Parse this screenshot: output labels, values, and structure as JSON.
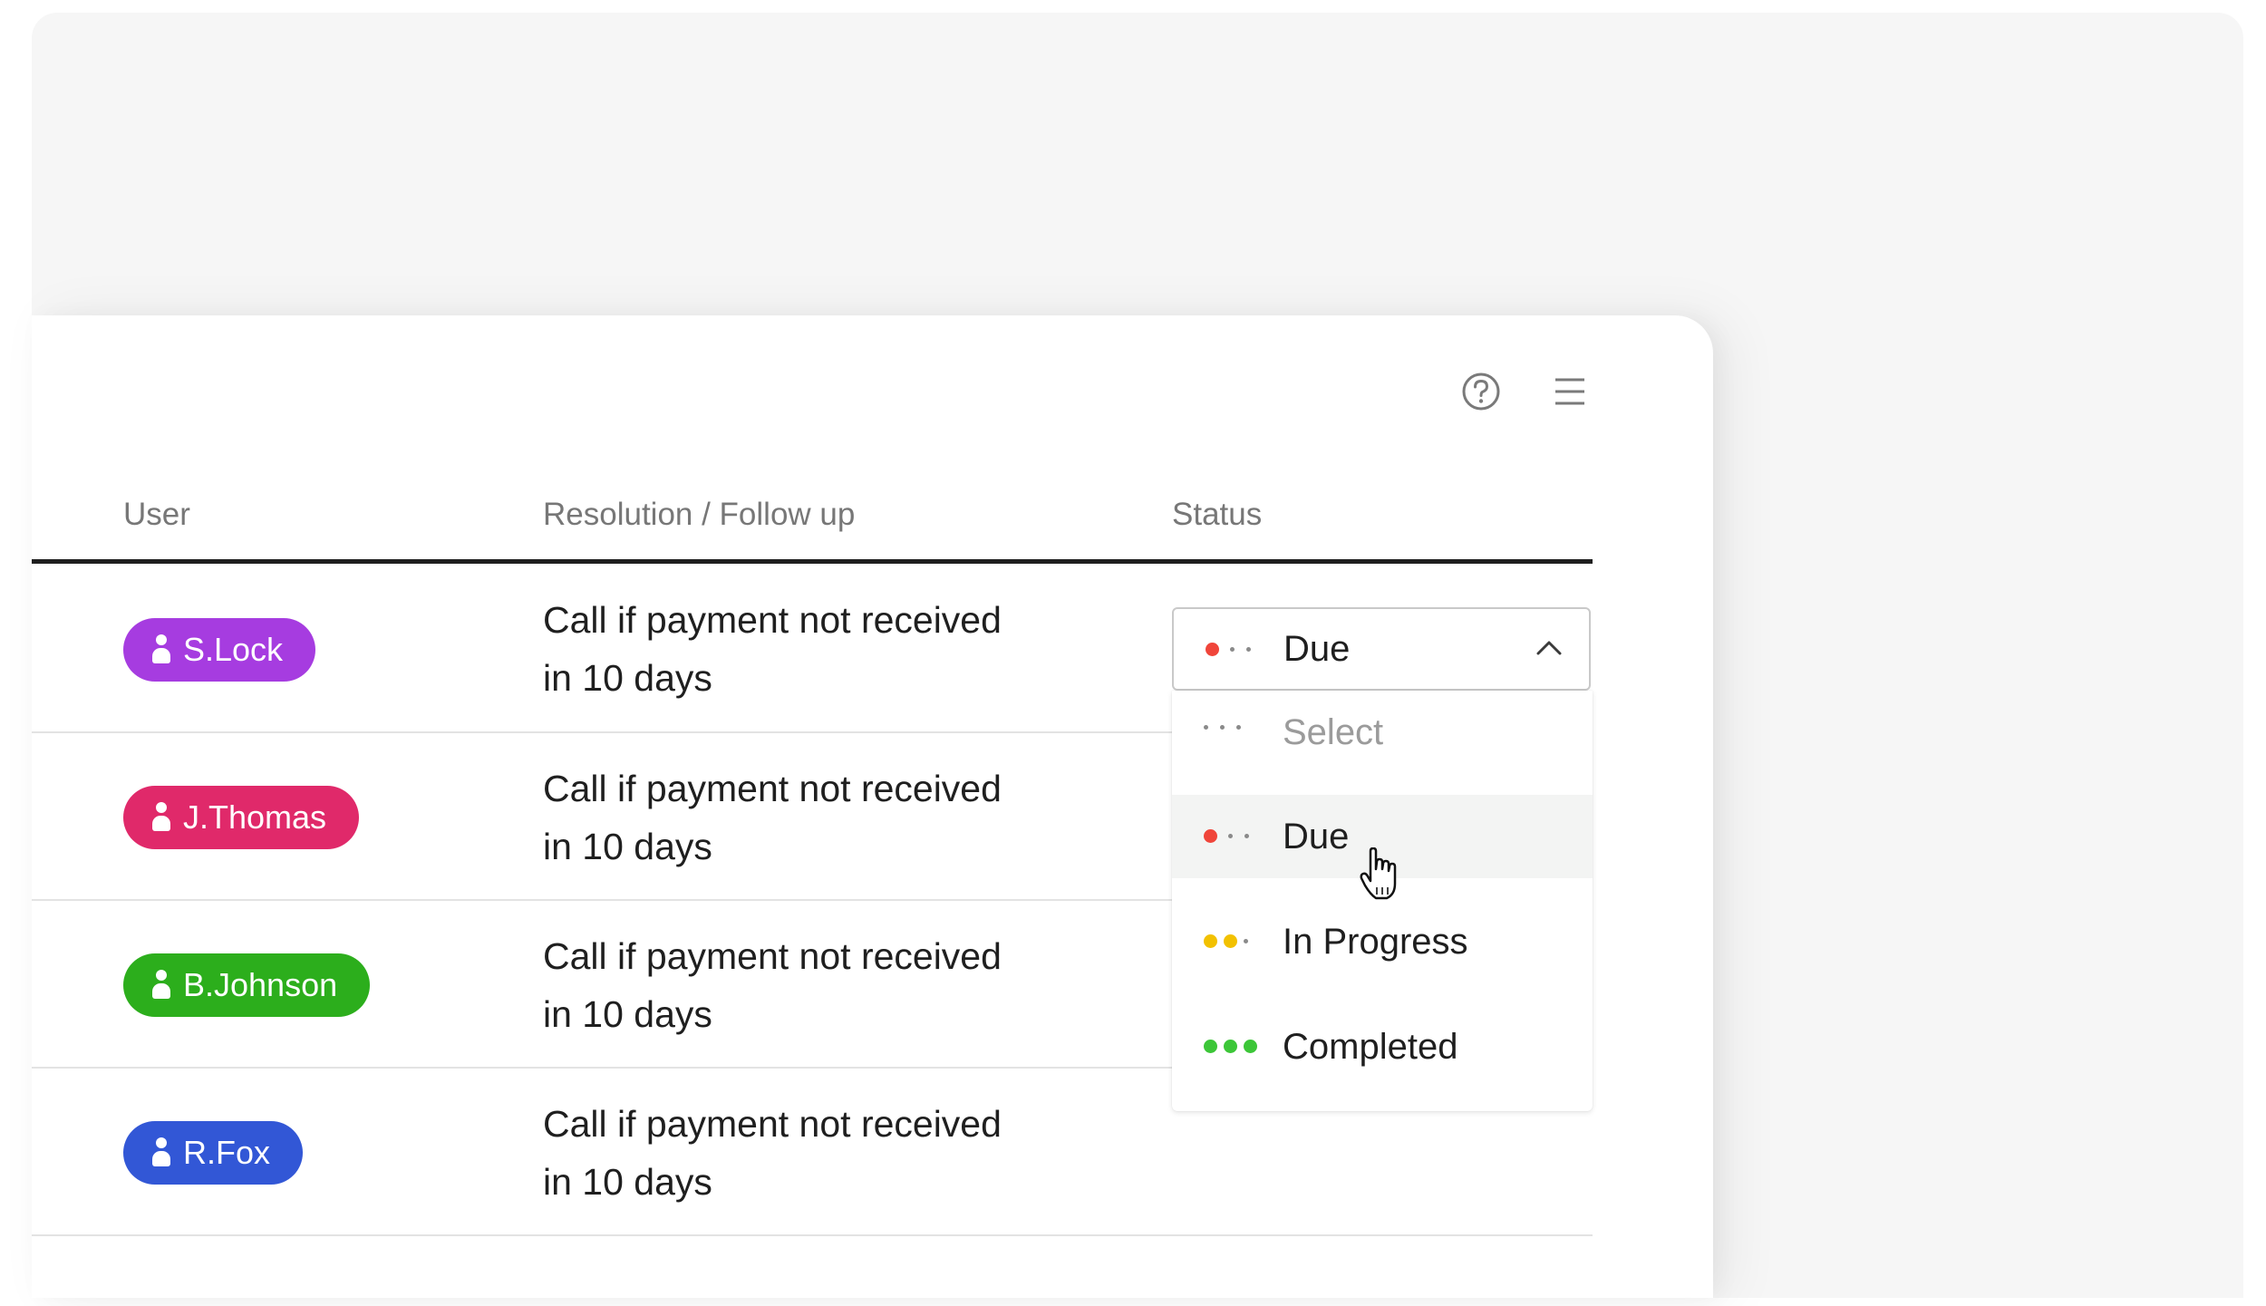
{
  "table": {
    "headers": {
      "user": "User",
      "resolution": "Resolution / Follow up",
      "status": "Status"
    },
    "rows": [
      {
        "user": "S.Lock",
        "color": "#a63ce0",
        "resolution_line1": "Call if payment not received",
        "resolution_line2": "in 10 days"
      },
      {
        "user": "J.Thomas",
        "color": "#e0296a",
        "resolution_line1": "Call if payment not received",
        "resolution_line2": "in 10 days"
      },
      {
        "user": "B.Johnson",
        "color": "#2cae1c",
        "resolution_line1": "Call if payment not received",
        "resolution_line2": "in 10 days"
      },
      {
        "user": "R.Fox",
        "color": "#3257d6",
        "resolution_line1": "Call if payment not received",
        "resolution_line2": "in 10 days"
      }
    ]
  },
  "status_select": {
    "value": "Due",
    "expanded": true,
    "options": [
      {
        "label": "Select",
        "placeholder": true
      },
      {
        "label": "Due",
        "hovered": true
      },
      {
        "label": "In Progress"
      },
      {
        "label": "Completed"
      }
    ]
  },
  "toolbar": {
    "icons": [
      "help-icon",
      "hamburger-menu-icon"
    ]
  },
  "colors": {
    "due": "#f0453a",
    "in_progress": "#f2c100",
    "completed": "#3cc638",
    "inactive_dot": "#8a8a8a"
  }
}
